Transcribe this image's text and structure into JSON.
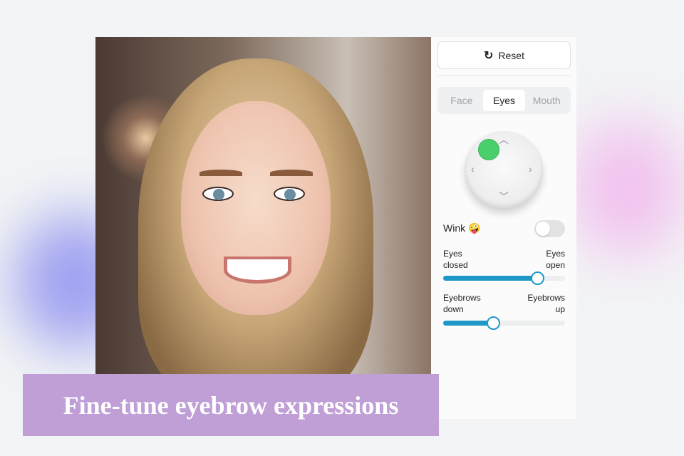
{
  "panel": {
    "reset_label": "Reset",
    "tabs": [
      "Face",
      "Eyes",
      "Mouth"
    ],
    "active_tab": "Eyes",
    "wink": {
      "label": "Wink",
      "emoji": "🤪",
      "enabled": false
    },
    "sliders": [
      {
        "left": "Eyes closed",
        "right": "Eyes open",
        "value_percent": 77
      },
      {
        "left": "Eyebrows down",
        "right": "Eyebrows up",
        "value_percent": 41
      }
    ]
  },
  "caption": "Fine-tune eyebrow expressions",
  "colors": {
    "accent": "#1e98c8",
    "knob": "#49cf6c",
    "caption_bg": "#bf9fd6"
  }
}
